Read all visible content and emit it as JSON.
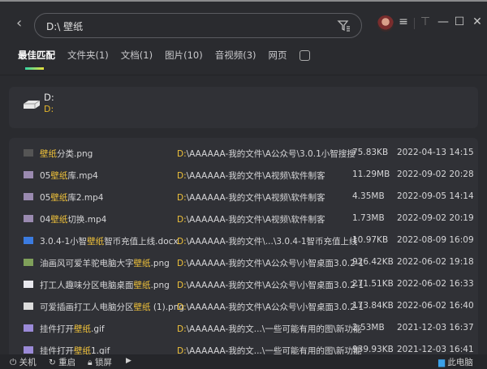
{
  "search": {
    "value": "D:\\ 壁纸"
  },
  "tabs": [
    {
      "label": "最佳匹配",
      "active": true
    },
    {
      "label": "文件夹(1)"
    },
    {
      "label": "文档(1)"
    },
    {
      "label": "图片(10)"
    },
    {
      "label": "音视频(3)"
    },
    {
      "label": "网页"
    }
  ],
  "drive": {
    "name": "D:",
    "path": "D:"
  },
  "colors": {
    "highlight": "#f0c23a",
    "background": "#2a2b2f",
    "card": "#303136"
  },
  "files": [
    {
      "pre": "",
      "hl": "壁纸",
      "post": "分类.png",
      "icon": "image-icon",
      "ic": "#555",
      "drive": "D:",
      "path": "\\AAAAAA-我的文件\\A公众号\\3.0.1小智搜搜",
      "size": "75.83KB",
      "date": "2022-04-13 14:15"
    },
    {
      "pre": "05",
      "hl": "壁纸",
      "post": "库.mp4",
      "icon": "video-icon",
      "ic": "#9a8ab0",
      "drive": "D:",
      "path": "\\AAAAAA-我的文件\\A视频\\软件制客",
      "size": "11.29MB",
      "date": "2022-09-02 20:28"
    },
    {
      "pre": "05",
      "hl": "壁纸",
      "post": "库2.mp4",
      "icon": "video-icon",
      "ic": "#9a8ab0",
      "drive": "D:",
      "path": "\\AAAAAA-我的文件\\A视频\\软件制客",
      "size": "4.35MB",
      "date": "2022-09-05 14:14"
    },
    {
      "pre": "04",
      "hl": "壁纸",
      "post": "切换.mp4",
      "icon": "video-icon",
      "ic": "#9a8ab0",
      "drive": "D:",
      "path": "\\AAAAAA-我的文件\\A视频\\软件制客",
      "size": "1.73MB",
      "date": "2022-09-02 20:19"
    },
    {
      "pre": "3.0.4-1小智",
      "hl": "壁纸",
      "post": "智币充值上线.docx",
      "icon": "word-doc-icon",
      "ic": "#3b7be0",
      "drive": "D:",
      "path": "\\AAAAAA-我的文件\\...\\3.0.4-1智币充值上线",
      "size": "10.97KB",
      "date": "2022-08-09 16:09"
    },
    {
      "pre": "油画风可爱羊驼电脑大字",
      "hl": "壁纸",
      "post": ".png",
      "icon": "image-icon",
      "ic": "#7fa05a",
      "drive": "D:",
      "path": "\\AAAAAA-我的文件\\A公众号\\小智桌面3.0.2-1",
      "size": "926.42KB",
      "date": "2022-06-02 19:18"
    },
    {
      "pre": "打工人趣味分区电脑桌面",
      "hl": "壁纸",
      "post": ".png",
      "icon": "image-icon",
      "ic": "#e8e8ee",
      "drive": "D:",
      "path": "\\AAAAAA-我的文件\\A公众号\\小智桌面3.0.2-1",
      "size": "271.51KB",
      "date": "2022-06-02 16:33"
    },
    {
      "pre": "可爱插画打工人电脑分区",
      "hl": "壁纸",
      "post": " (1).png",
      "icon": "image-icon",
      "ic": "#dcdcdc",
      "drive": "D:",
      "path": "\\AAAAAA-我的文件\\A公众号\\小智桌面3.0.2-1",
      "size": "173.84KB",
      "date": "2022-06-02 16:40"
    },
    {
      "pre": "挂件打开",
      "hl": "壁纸",
      "post": ".gif",
      "icon": "gif-icon",
      "ic": "#9b8ad8",
      "drive": "D:",
      "path": "\\AAAAAA-我的文...\\一些可能有用的图\\新功能",
      "size": "2.53MB",
      "date": "2021-12-03 16:37"
    },
    {
      "pre": "挂件打开",
      "hl": "壁纸",
      "post": "1.gif",
      "icon": "gif-icon",
      "ic": "#9b8ad8",
      "drive": "D:",
      "path": "\\AAAAAA-我的文...\\一些可能有用的图\\新功能",
      "size": "939.93KB",
      "date": "2021-12-03 16:41"
    }
  ],
  "footer": {
    "shutdown": "关机",
    "restart": "重启",
    "lock": "锁屏",
    "computer": "此电脑"
  }
}
